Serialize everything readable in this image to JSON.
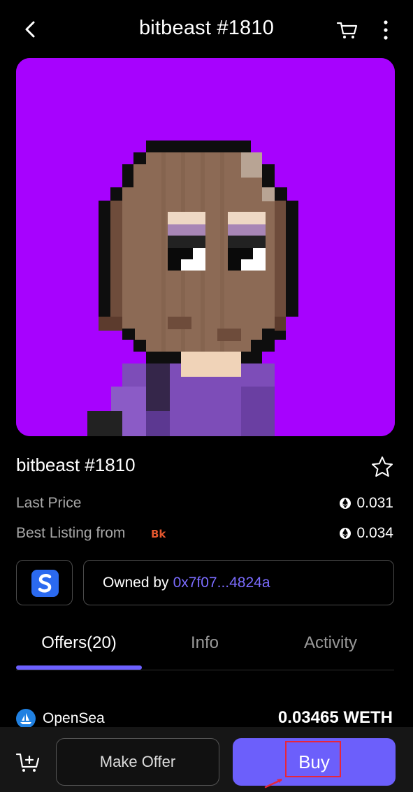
{
  "header": {
    "title": "bitbeast #1810"
  },
  "nft": {
    "name": "bitbeast #1810",
    "background_color": "#a702fe"
  },
  "stats": {
    "last_price_label": "Last Price",
    "last_price_value": "0.031",
    "best_listing_label": "Best Listing from",
    "best_listing_value": "0.034"
  },
  "owner": {
    "label": "Owned by",
    "address": "0x7f07...4824a"
  },
  "tabs": [
    {
      "label": "Offers(20)",
      "active": true
    },
    {
      "label": "Info",
      "active": false
    },
    {
      "label": "Activity",
      "active": false
    }
  ],
  "offers": [
    {
      "marketplace": "OpenSea",
      "price": "0.03465 WETH"
    }
  ],
  "actions": {
    "make_offer": "Make Offer",
    "buy": "Buy"
  },
  "colors": {
    "accent": "#6c5ffb",
    "address": "#7b6cff",
    "highlight": "#e8263a"
  }
}
